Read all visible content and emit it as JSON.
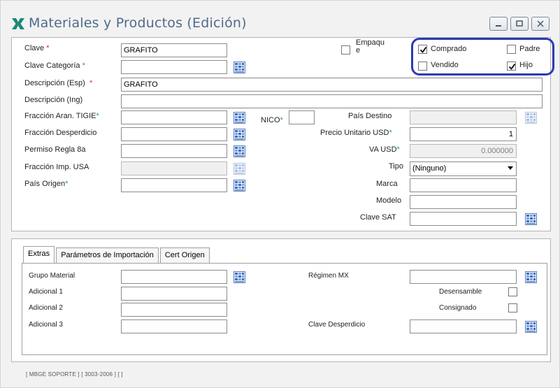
{
  "window": {
    "title": "Materiales y Productos (Edición)",
    "controls": [
      "minimize",
      "maximize",
      "close"
    ]
  },
  "form": {
    "clave": {
      "label": "Clave",
      "value": "GRAFITO"
    },
    "clave_categoria": {
      "label": "Clave Categoría",
      "value": ""
    },
    "descripcion_esp": {
      "label": "Descripción (Esp)",
      "value": "GRAFITO"
    },
    "descripcion_ing": {
      "label": "Descripción (Ing)",
      "value": ""
    },
    "fraccion_aran": {
      "label": "Fracción Aran. TIGIE",
      "value": ""
    },
    "nico": {
      "label": "NICO",
      "value": ""
    },
    "pais_destino": {
      "label": "País Destino",
      "value": ""
    },
    "fraccion_desperdicio": {
      "label": "Fracción Desperdicio",
      "value": ""
    },
    "precio_unitario": {
      "label": "Precio Unitario USD",
      "value": "1"
    },
    "permiso_regla": {
      "label": "Permiso Regla 8a",
      "value": ""
    },
    "va_usd": {
      "label": "VA USD",
      "value": "0.000000"
    },
    "fraccion_imp_usa": {
      "label": "Fracción Imp. USA",
      "value": ""
    },
    "tipo": {
      "label": "Tipo",
      "value": "(Ninguno)"
    },
    "pais_origen": {
      "label": "País Origen",
      "value": ""
    },
    "marca": {
      "label": "Marca",
      "value": ""
    },
    "modelo": {
      "label": "Modelo",
      "value": ""
    },
    "clave_sat": {
      "label": "Clave SAT",
      "value": ""
    },
    "required_mark": "*"
  },
  "checks": {
    "empaque": {
      "label_top": "Empaqu",
      "label_bottom": "e",
      "checked": false
    },
    "comprado": {
      "label": "Comprado",
      "checked": true
    },
    "padre": {
      "label": "Padre",
      "checked": false
    },
    "vendido": {
      "label": "Vendido",
      "checked": false
    },
    "hijo": {
      "label": "Hijo",
      "checked": true
    }
  },
  "tabs": [
    {
      "label": "Extras",
      "active": true
    },
    {
      "label": "Parámetros de Importación",
      "active": false
    },
    {
      "label": "Cert Origen",
      "active": false
    }
  ],
  "extras": {
    "grupo_material": {
      "label": "Grupo Material",
      "value": ""
    },
    "adicional_1": {
      "label": "Adicional 1",
      "value": ""
    },
    "adicional_2": {
      "label": "Adicional 2",
      "value": ""
    },
    "adicional_3": {
      "label": "Adicional 3",
      "value": ""
    },
    "regimen_mx": {
      "label": "Régimen MX",
      "value": ""
    },
    "desensamble": {
      "label": "Desensamble",
      "checked": false
    },
    "consignado": {
      "label": "Consignado",
      "checked": false
    },
    "clave_desperdicio": {
      "label": "Clave Desperdicio",
      "value": ""
    }
  },
  "status_bar": "[ MBGE SOPORTE ]  [ 3003-2006 ]  [  ]",
  "colors": {
    "title": "#4f6b8c",
    "required_red": "#d8262c",
    "required_green": "#28a046",
    "highlight": "#2c3ab3",
    "logo": "#1a8a78"
  },
  "icons": {
    "picker": "grid-picker-icon",
    "logo": "x-logo-icon"
  }
}
